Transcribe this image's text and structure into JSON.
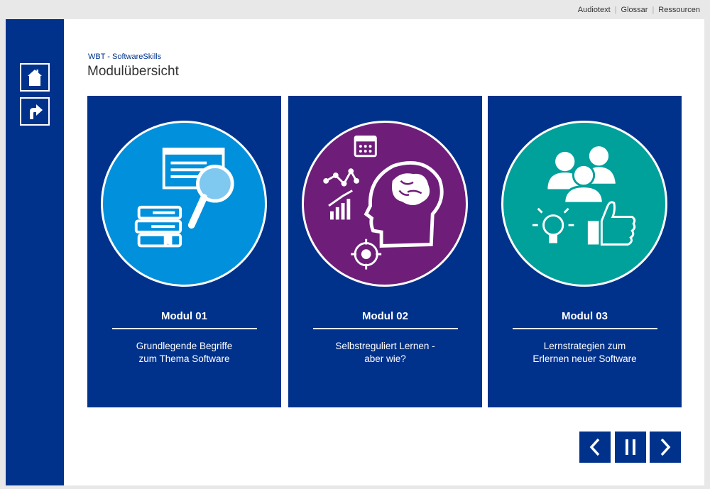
{
  "topbar": {
    "links": [
      "Audiotext",
      "Glossar",
      "Ressourcen"
    ]
  },
  "header": {
    "subtitle": "WBT - SoftwareSkills",
    "title": "Modulübersicht"
  },
  "sidebar": {
    "home_icon": "home-icon",
    "back_icon": "return-arrow-icon"
  },
  "modules": [
    {
      "heading": "Modul 01",
      "desc_line1": "Grundlegende Begriffe",
      "desc_line2": "zum Thema Software",
      "color": "#0090dc"
    },
    {
      "heading": "Modul 02",
      "desc_line1": "Selbstreguliert Lernen -",
      "desc_line2": "aber wie?",
      "color": "#6e1e78"
    },
    {
      "heading": "Modul 03",
      "desc_line1": "Lernstrategien zum",
      "desc_line2": "Erlernen neuer Software",
      "color": "#00a09b"
    }
  ],
  "nav": {
    "prev_icon": "chevron-left-icon",
    "pause_icon": "pause-icon",
    "next_icon": "chevron-right-icon"
  },
  "colors": {
    "brand_blue": "#00328c",
    "background": "#e8e8e8"
  }
}
